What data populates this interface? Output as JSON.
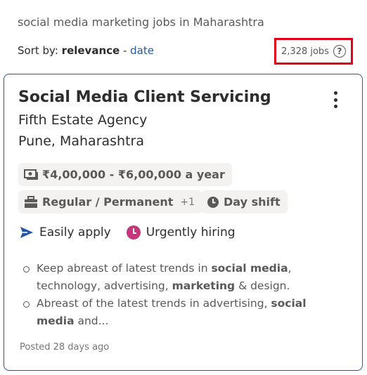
{
  "search": {
    "query": "social media marketing jobs in Maharashtra"
  },
  "sort": {
    "prefix": "Sort by:",
    "active": "relevance",
    "separator": " - ",
    "alternative": "date"
  },
  "results": {
    "count_label": "2,328 jobs",
    "help_icon": "question-circle-icon",
    "highlight_color": "#e3001b"
  },
  "job": {
    "title": "Social Media Client Servicing",
    "company": "Fifth Estate Agency",
    "location": "Pune, Maharashtra",
    "salary": "₹4,00,000 - ₹6,00,000 a year",
    "job_type": "Regular / Permanent",
    "job_type_extra": "+1",
    "shift": "Day shift",
    "badges": [
      "Easily apply",
      "Urgently hiring"
    ],
    "snippet": [
      {
        "parts": [
          "Keep abreast of latest trends in ",
          "social media",
          ", technology, advertising, ",
          "marketing",
          " & design."
        ]
      },
      {
        "parts": [
          "Abreast of the latest trends in advertising, ",
          "social media",
          " and..."
        ]
      }
    ],
    "posted": "Posted 28 days ago",
    "accent_color": "#2557a7",
    "urgent_color": "#c4377b"
  }
}
